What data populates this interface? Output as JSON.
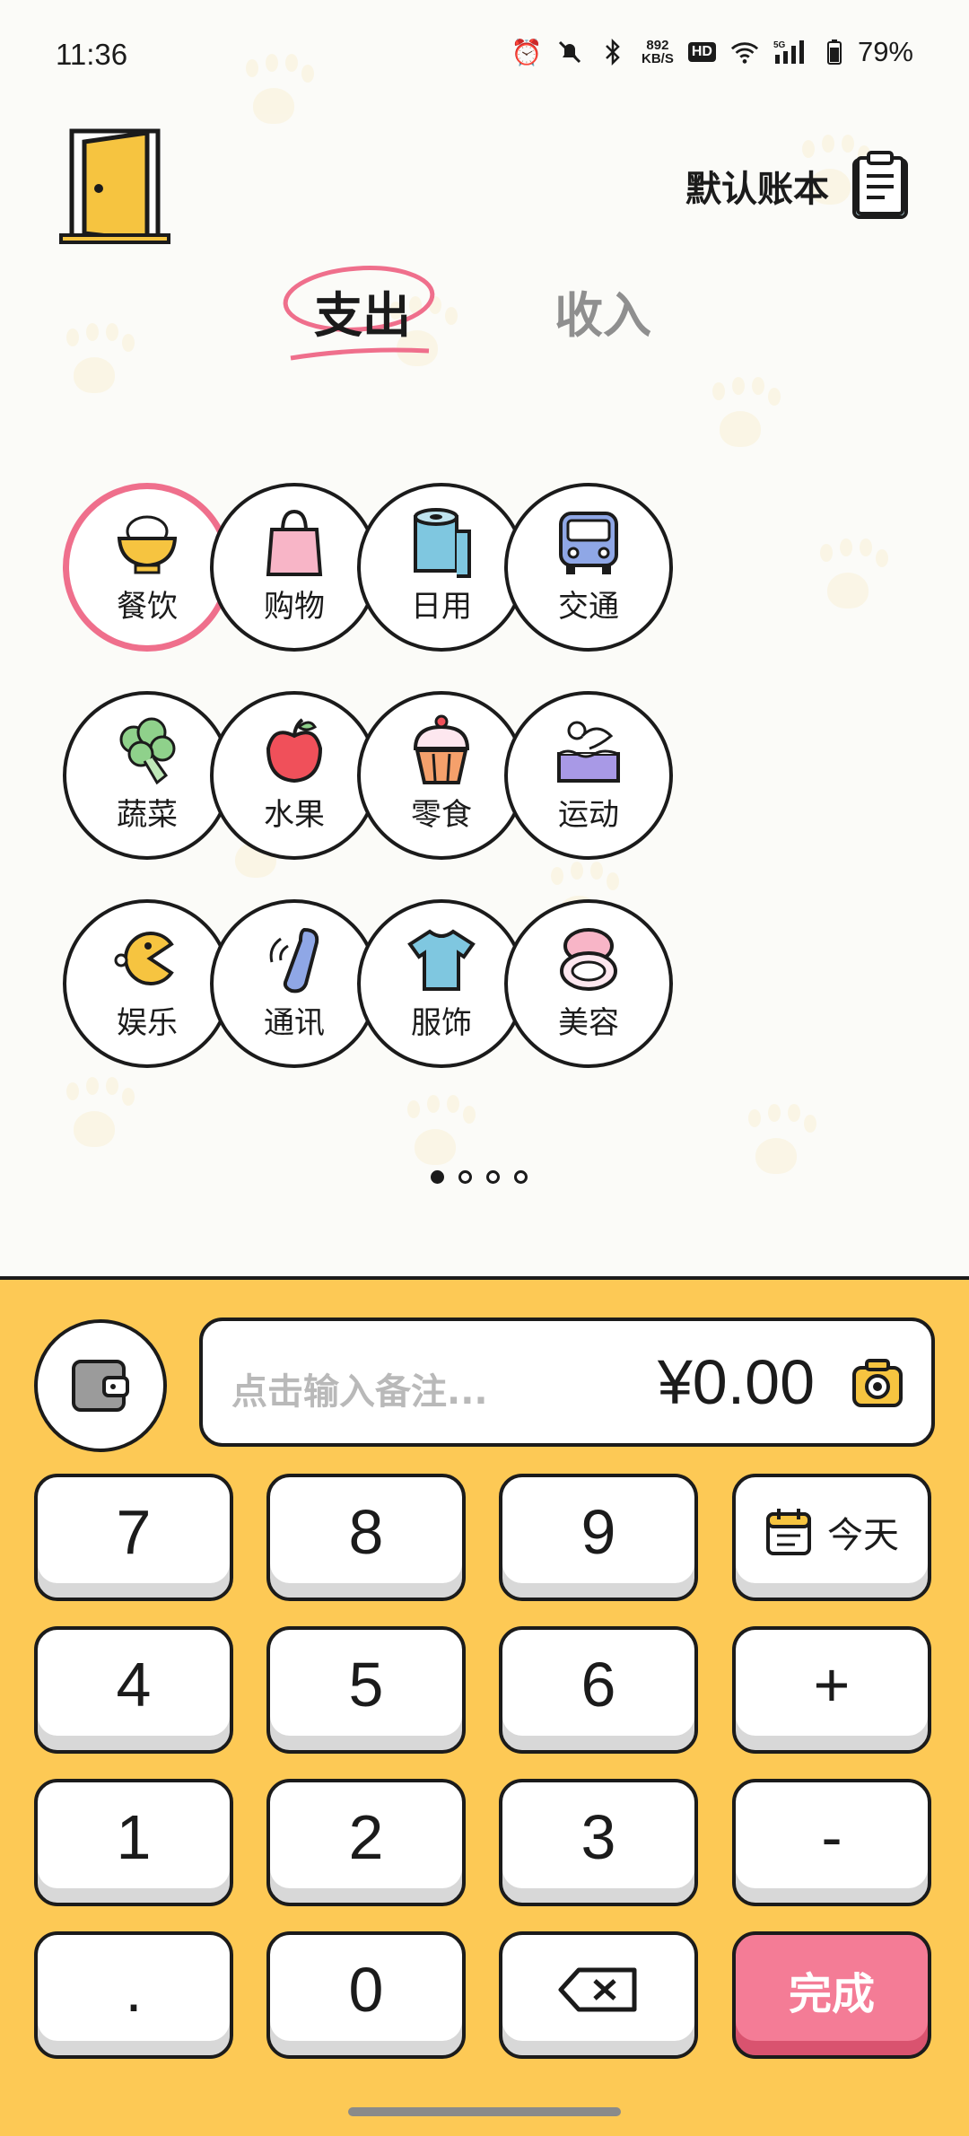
{
  "status_bar": {
    "time": "11:36",
    "speed_value": "892",
    "speed_unit": "KB/S",
    "hd": "HD",
    "network": "5G",
    "battery": "79%"
  },
  "header": {
    "account_book": "默认账本",
    "tabs": [
      {
        "label": "支出",
        "selected": true
      },
      {
        "label": "收入",
        "selected": false
      }
    ]
  },
  "categories": [
    {
      "label": "餐饮",
      "icon": "rice-bowl-icon",
      "selected": true
    },
    {
      "label": "购物",
      "icon": "shopping-bag-icon"
    },
    {
      "label": "日用",
      "icon": "toilet-paper-icon"
    },
    {
      "label": "交通",
      "icon": "bus-icon"
    },
    {
      "label": "蔬菜",
      "icon": "broccoli-icon"
    },
    {
      "label": "水果",
      "icon": "apple-icon"
    },
    {
      "label": "零食",
      "icon": "cupcake-icon"
    },
    {
      "label": "运动",
      "icon": "swimmer-icon"
    },
    {
      "label": "娱乐",
      "icon": "pacman-icon"
    },
    {
      "label": "通讯",
      "icon": "phone-icon"
    },
    {
      "label": "服饰",
      "icon": "tshirt-icon"
    },
    {
      "label": "美容",
      "icon": "compact-mirror-icon"
    }
  ],
  "pager": {
    "count": 4,
    "active": 1
  },
  "input": {
    "placeholder": "点击输入备注...",
    "amount": "¥0.00"
  },
  "keypad": {
    "k7": "7",
    "k8": "8",
    "k9": "9",
    "today": "今天",
    "k4": "4",
    "k5": "5",
    "k6": "6",
    "plus": "+",
    "k1": "1",
    "k2": "2",
    "k3": "3",
    "minus": "-",
    "dot": ".",
    "k0": "0",
    "done": "完成"
  },
  "colors": {
    "accent_pink": "#ef6f8c",
    "panel_yellow": "#fdc955",
    "done_button": "#f47c96"
  }
}
